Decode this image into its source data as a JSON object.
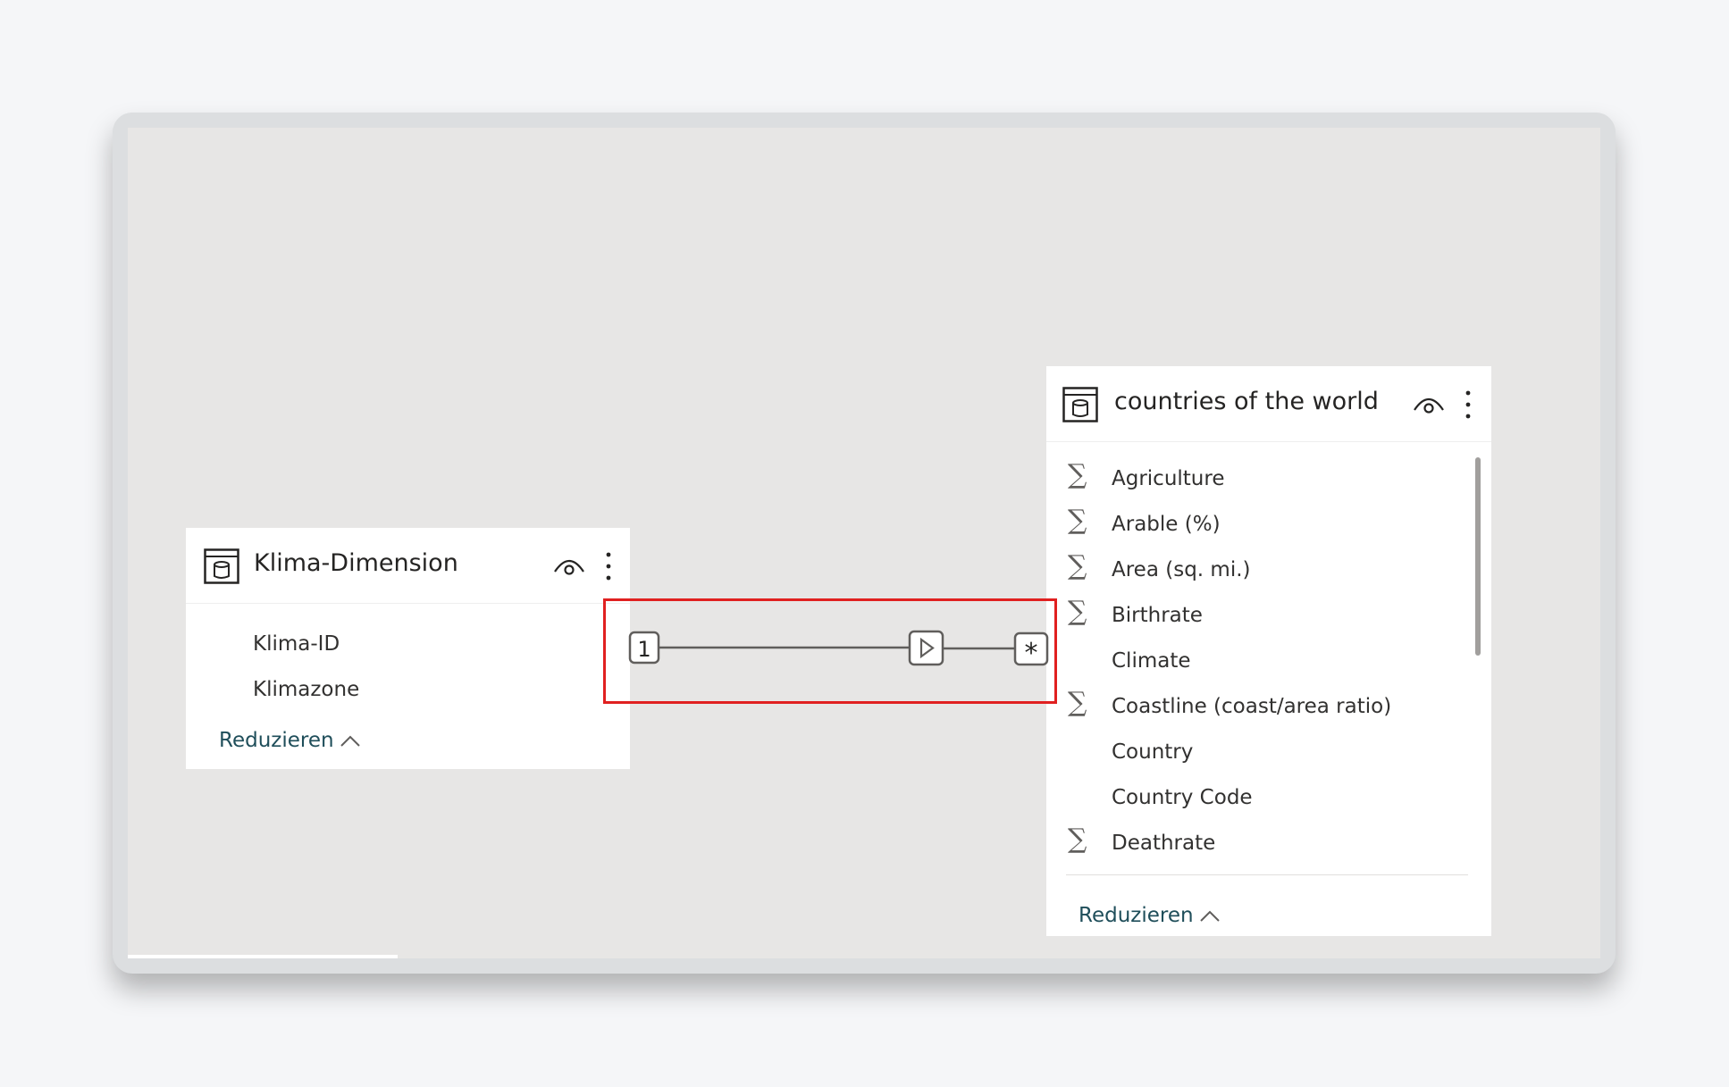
{
  "tables": [
    {
      "title": "Klima-Dimension",
      "fields": [
        {
          "name": "Klima-ID",
          "sigma": false
        },
        {
          "name": "Klimazone",
          "sigma": false
        }
      ],
      "collapse_label": "Reduzieren"
    },
    {
      "title": "countries of the world",
      "fields": [
        {
          "name": "Agriculture",
          "sigma": true
        },
        {
          "name": "Arable (%)",
          "sigma": true
        },
        {
          "name": "Area (sq. mi.)",
          "sigma": true
        },
        {
          "name": "Birthrate",
          "sigma": true
        },
        {
          "name": "Climate",
          "sigma": false
        },
        {
          "name": "Coastline (coast/area ratio)",
          "sigma": true
        },
        {
          "name": "Country",
          "sigma": false
        },
        {
          "name": "Country Code",
          "sigma": false
        },
        {
          "name": "Deathrate",
          "sigma": true
        }
      ],
      "collapse_label": "Reduzieren"
    }
  ],
  "relationship": {
    "from_cardinality": "1",
    "to_cardinality": "*",
    "highlight_color": "#e02020"
  },
  "icons": {
    "sigma": "∑",
    "table": "table-icon",
    "visibility": "eye-icon",
    "more": "more-options-icon",
    "collapse": "chevron-up-icon",
    "filter_direction": "filter-direction-arrow-icon"
  }
}
